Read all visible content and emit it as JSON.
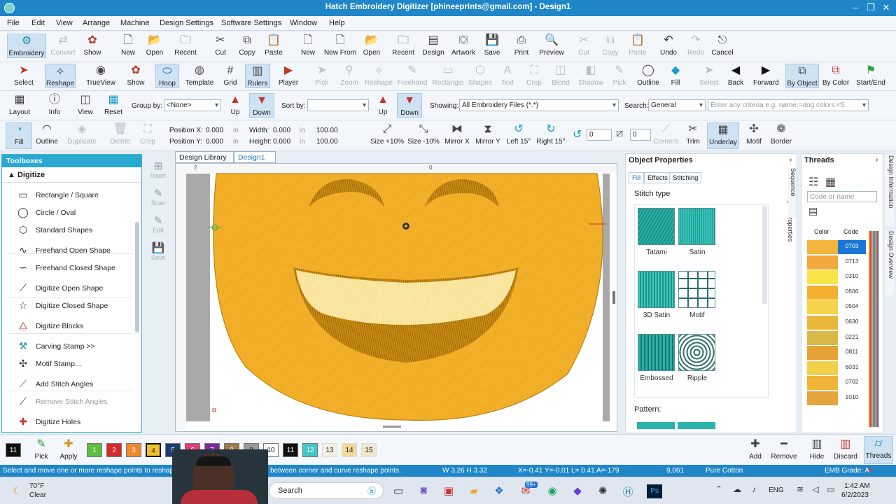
{
  "title": "Hatch Embroidery Digitizer [phineeprints@gmail.com] - Design1",
  "menu": [
    "File",
    "Edit",
    "View",
    "Arrange",
    "Machine",
    "Design Settings",
    "Software Settings",
    "Window",
    "Help"
  ],
  "toolbar1": [
    {
      "label": "Embroidery",
      "icon": "embroidery-icon",
      "active": true,
      "dis": false
    },
    {
      "label": "Convert",
      "icon": "convert-icon",
      "dis": true
    },
    {
      "label": "Show",
      "icon": "show-icon",
      "dis": false
    },
    {
      "label": "New",
      "icon": "new-doc-icon",
      "dis": false
    },
    {
      "label": "Open",
      "icon": "open-folder-icon",
      "dis": false
    },
    {
      "label": "Recent",
      "icon": "recent-icon",
      "dis": false
    },
    {
      "label": "Cut",
      "icon": "cut-icon",
      "dis": false
    },
    {
      "label": "Copy",
      "icon": "copy-icon",
      "dis": false
    },
    {
      "label": "Paste",
      "icon": "paste-icon",
      "dis": false
    },
    {
      "label": "New",
      "icon": "new-doc-icon",
      "dis": false
    },
    {
      "label": "New From",
      "icon": "new-from-icon",
      "dis": false
    },
    {
      "label": "Open",
      "icon": "open-folder-icon",
      "dis": false
    },
    {
      "label": "Recent",
      "icon": "recent-icon",
      "dis": false
    },
    {
      "label": "Design",
      "icon": "design-icon",
      "dis": false
    },
    {
      "label": "Artwork",
      "icon": "artwork-icon",
      "dis": false
    },
    {
      "label": "Save",
      "icon": "save-icon",
      "dis": false
    },
    {
      "label": "Print",
      "icon": "print-icon",
      "dis": false
    },
    {
      "label": "Preview",
      "icon": "preview-icon",
      "dis": false
    },
    {
      "label": "Cut",
      "icon": "cut-icon",
      "dis": true
    },
    {
      "label": "Copy",
      "icon": "copy-icon",
      "dis": true
    },
    {
      "label": "Paste",
      "icon": "paste-icon",
      "dis": true
    },
    {
      "label": "Undo",
      "icon": "undo-icon",
      "dis": false
    },
    {
      "label": "Redo",
      "icon": "redo-icon",
      "dis": true
    },
    {
      "label": "Cancel",
      "icon": "esc-icon",
      "dis": false
    }
  ],
  "toolbar2": [
    {
      "label": "Select",
      "icon": "select-arrow-icon",
      "dis": false
    },
    {
      "label": "Reshape",
      "icon": "reshape-icon",
      "active": true,
      "dis": false
    },
    {
      "label": "TrueView",
      "icon": "trueview-eye-icon",
      "dis": false
    },
    {
      "label": "Show",
      "icon": "show-icon",
      "dis": false
    },
    {
      "label": "Hoop",
      "icon": "hoop-icon",
      "active": true,
      "dis": false
    },
    {
      "label": "Template",
      "icon": "template-icon",
      "dis": false
    },
    {
      "label": "Grid",
      "icon": "grid-icon",
      "dis": false
    },
    {
      "label": "Rulers",
      "icon": "rulers-icon",
      "active": true,
      "dis": false
    },
    {
      "label": "Player",
      "icon": "player-icon",
      "dis": false
    },
    {
      "label": "Pick",
      "icon": "pick-icon",
      "dis": true
    },
    {
      "label": "Zoom",
      "icon": "zoom-icon",
      "dis": true
    },
    {
      "label": "Reshape",
      "icon": "reshape-icon",
      "dis": true
    },
    {
      "label": "Freehand",
      "icon": "freehand-icon",
      "dis": true
    },
    {
      "label": "Rectangle",
      "icon": "rectangle-icon",
      "dis": true
    },
    {
      "label": "Shapes",
      "icon": "shapes-icon",
      "dis": true
    },
    {
      "label": "Text",
      "icon": "text-icon",
      "dis": true
    },
    {
      "label": "Crop",
      "icon": "crop-icon",
      "dis": true
    },
    {
      "label": "Blend",
      "icon": "blend-icon",
      "dis": true
    },
    {
      "label": "Shadow",
      "icon": "shadow-icon",
      "dis": true
    },
    {
      "label": "Pick",
      "icon": "pick-color-icon",
      "dis": true
    },
    {
      "label": "Outline",
      "icon": "outline-icon",
      "dis": false
    },
    {
      "label": "Fill",
      "icon": "fill-icon",
      "dis": false
    },
    {
      "label": "Select",
      "icon": "select-icon",
      "dis": true
    },
    {
      "label": "Back",
      "icon": "back-icon",
      "dis": false
    },
    {
      "label": "Forward",
      "icon": "forward-icon",
      "dis": false
    },
    {
      "label": "By Object",
      "icon": "by-object-icon",
      "active": true,
      "dis": false
    },
    {
      "label": "By Color",
      "icon": "by-color-icon",
      "dis": false
    },
    {
      "label": "Start/End",
      "icon": "start-end-icon",
      "dis": false
    }
  ],
  "toolbar3": {
    "buttons": [
      {
        "label": "Layout",
        "icon": "layout-icon"
      },
      {
        "label": "Info",
        "icon": "info-icon"
      },
      {
        "label": "View",
        "icon": "view-icon"
      },
      {
        "label": "Reset",
        "icon": "reset-icon"
      }
    ],
    "group_by_label": "Group by:",
    "group_by_value": "<None>",
    "up1": "Up",
    "down1": "Down",
    "sort_by_label": "Sort by:",
    "sort_by_value": "",
    "up2": "Up",
    "down2": "Down",
    "showing_label": "Showing:",
    "showing_value": "All Embroidery Files (*.*)",
    "search_label": "Search:",
    "search_value": "General",
    "criteria_placeholder": "Enter any criteria e.g. name:=dog colors:<5"
  },
  "toolbar4": {
    "fill": "Fill",
    "outline": "Outline",
    "duplicate": "Duplicate",
    "delete": "Delete",
    "crop": "Crop",
    "pos_x_label": "Position X:",
    "pos_x": "0.000",
    "pos_y_label": "Position Y:",
    "pos_y": "0.000",
    "width_label": "Width:",
    "width": "0.000",
    "height_label": "Height:",
    "height": "0.000",
    "unit": "in",
    "pct1": "100.00",
    "pct2": "100.00",
    "size_plus": "Size +10%",
    "size_minus": "Size -10%",
    "mirror_x": "Mirror X",
    "mirror_y": "Mirror Y",
    "left15": "Left 15°",
    "right15": "Right 15°",
    "deg_label": "15°",
    "rotate_val": "0",
    "skew_val": "0",
    "corners": "Corners",
    "trim": "Trim",
    "underlay": "Underlay",
    "motif": "Motif",
    "border": "Border"
  },
  "toolbox": {
    "header": "Toolboxes",
    "section": "Digitize",
    "items": [
      {
        "label": "Rectangle / Square",
        "icon": "rectangle-icon",
        "dis": false
      },
      {
        "label": "Circle / Oval",
        "icon": "circle-icon",
        "dis": false
      },
      {
        "label": "Standard Shapes",
        "icon": "shapes-icon",
        "dis": false
      },
      {
        "label": "Freehand Open Shape",
        "icon": "freehand-open-icon",
        "dis": false
      },
      {
        "label": "Freehand Closed Shape",
        "icon": "freehand-closed-icon",
        "dis": false
      },
      {
        "label": "Digitize Open Shape",
        "icon": "digitize-open-icon",
        "dis": false
      },
      {
        "label": "Digitize Closed Shape",
        "icon": "star-icon",
        "dis": false
      },
      {
        "label": "Digitize Blocks",
        "icon": "digitize-blocks-icon",
        "dis": false
      },
      {
        "label": "Carving Stamp >>",
        "icon": "carving-stamp-icon",
        "dis": false
      },
      {
        "label": "Motif Stamp...",
        "icon": "motif-stamp-icon",
        "dis": false
      },
      {
        "label": "Add Stitch Angles",
        "icon": "add-angles-icon",
        "dis": false
      },
      {
        "label": "Remove Stitch Angles",
        "icon": "remove-angles-icon",
        "dis": true
      },
      {
        "label": "Digitize Holes",
        "icon": "digitize-holes-icon",
        "dis": false
      }
    ]
  },
  "side_tools": [
    "Insert",
    "Scan",
    "Edit",
    "Save"
  ],
  "tabs": [
    "Design Library",
    "Design1"
  ],
  "object_properties": {
    "title": "Object Properties",
    "tabs": [
      "Fill",
      "Effects",
      "Stitching"
    ],
    "stitch_type_label": "Stitch type",
    "stitch_types": [
      "Tatami",
      "Satin",
      "3D Satin",
      "Motif",
      "Embossed",
      "Ripple"
    ],
    "pattern_label": "Pattern:",
    "side_tab_1": "Sequence",
    "side_tab_2": "Object Properties"
  },
  "threads": {
    "title": "Threads",
    "search_placeholder": "Code or name",
    "col_color": "Color",
    "col_code": "Code",
    "rows": [
      {
        "code": "0703",
        "color": "#f2b43c",
        "selected": true
      },
      {
        "code": "0713",
        "color": "#f2a83a"
      },
      {
        "code": "0310",
        "color": "#f7e548"
      },
      {
        "code": "0506",
        "color": "#f1b12f"
      },
      {
        "code": "0504",
        "color": "#f6d44a"
      },
      {
        "code": "0630",
        "color": "#e9b73b"
      },
      {
        "code": "0221",
        "color": "#d9b847"
      },
      {
        "code": "0811",
        "color": "#e6a235"
      },
      {
        "code": "6031",
        "color": "#f3cf4a"
      },
      {
        "code": "0702",
        "color": "#f0b438"
      },
      {
        "code": "1010",
        "color": "#e7a33c"
      }
    ],
    "side_tab_1": "Design Information",
    "side_tab_2": "Design Overview"
  },
  "palette": {
    "chips": [
      {
        "n": "11",
        "c": "#101010"
      },
      {
        "n": "1",
        "c": "#5fbe3c"
      },
      {
        "n": "2",
        "c": "#d42a2a"
      },
      {
        "n": "3",
        "c": "#f08a2a"
      },
      {
        "n": "4",
        "c": "#f2c12e"
      },
      {
        "n": "5",
        "c": "#1b3c6e"
      },
      {
        "n": "6",
        "c": "#e23e72"
      },
      {
        "n": "7",
        "c": "#7c2a9a"
      },
      {
        "n": "8",
        "c": "#9a7a4a"
      },
      {
        "n": "9",
        "c": "#9a9a9a"
      },
      {
        "n": "10",
        "c": "#ffffff"
      },
      {
        "n": "11",
        "c": "#101010"
      },
      {
        "n": "12",
        "c": "#3fc8c8"
      },
      {
        "n": "13",
        "c": "#f4f1e2"
      },
      {
        "n": "14",
        "c": "#f3d99a"
      },
      {
        "n": "15",
        "c": "#f0e6cf"
      }
    ],
    "pick": "Pick",
    "apply": "Apply",
    "add": "Add",
    "remove": "Remove",
    "hide": "Hide",
    "discard": "Discard",
    "threads": "Threads"
  },
  "status": {
    "hint": "Select and move one or more reshape points to reshape",
    "hint2": "between corner and curve reshape points.",
    "wh": "W 3.26 H 3.32",
    "coords": "X=-0.41 Y=-0.01 L= 0.41 A=-179",
    "count": "9,061",
    "thread": "Pure Cotton",
    "grade": "EMB Grade: A"
  },
  "taskbar": {
    "temp": "70°F",
    "weather": "Clear",
    "search": "Search",
    "badge": "99+",
    "lang": "ENG",
    "time": "1:42 AM",
    "date": "6/2/2023"
  },
  "colors": {
    "accent": "#1e86c9",
    "smiley": "#f4b12a",
    "smiley_dark": "#c98a12",
    "mouth_light": "#fbe8a4"
  }
}
